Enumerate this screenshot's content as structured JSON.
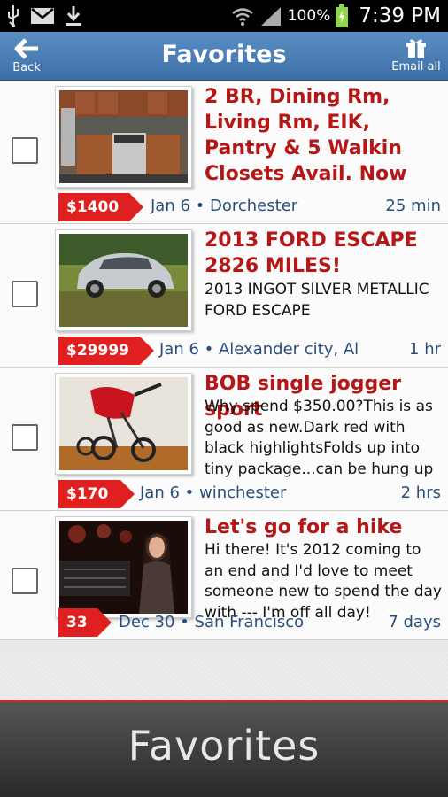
{
  "status_bar": {
    "battery_percent": "100%",
    "time": "7:39 PM"
  },
  "header": {
    "back_label": "Back",
    "title": "Favorites",
    "email_all_label": "Email all"
  },
  "listings": [
    {
      "title": "2 BR, Dining Rm, Living Rm, EIK, Pantry & 5 Walkin Closets Avail. Now",
      "description": "",
      "price": "$1400",
      "meta": "Jan 6 • Dorchester",
      "age": "25 min"
    },
    {
      "title": "2013 FORD ESCAPE 2826 MILES!",
      "description": "2013 INGOT SILVER METALLIC FORD ESCAPE",
      "price": "$29999",
      "meta": "Jan 6 • Alexander city, Al",
      "age": "1 hr"
    },
    {
      "title": "BOB single jogger sport",
      "description": "Why spend $350.00?This is as good as new.Dark red with black highlightsFolds up into tiny package...can be hung up",
      "price": "$170",
      "meta": "Jan 6 • winchester",
      "age": "2 hrs"
    },
    {
      "title": "Let's go for a hike",
      "description": "Hi there! It's 2012 coming to an end and I'd love to meet someone new to spend the day with --- I'm off all day!",
      "price": "33",
      "meta": "Dec 30 • San Francisco",
      "age": "7 days"
    }
  ],
  "bottom_bar": {
    "title": "Favorites"
  },
  "colors": {
    "header_blue": "#4a7fb6",
    "title_red": "#b51616",
    "price_red": "#e02020",
    "meta_blue": "#2a4f7d"
  }
}
